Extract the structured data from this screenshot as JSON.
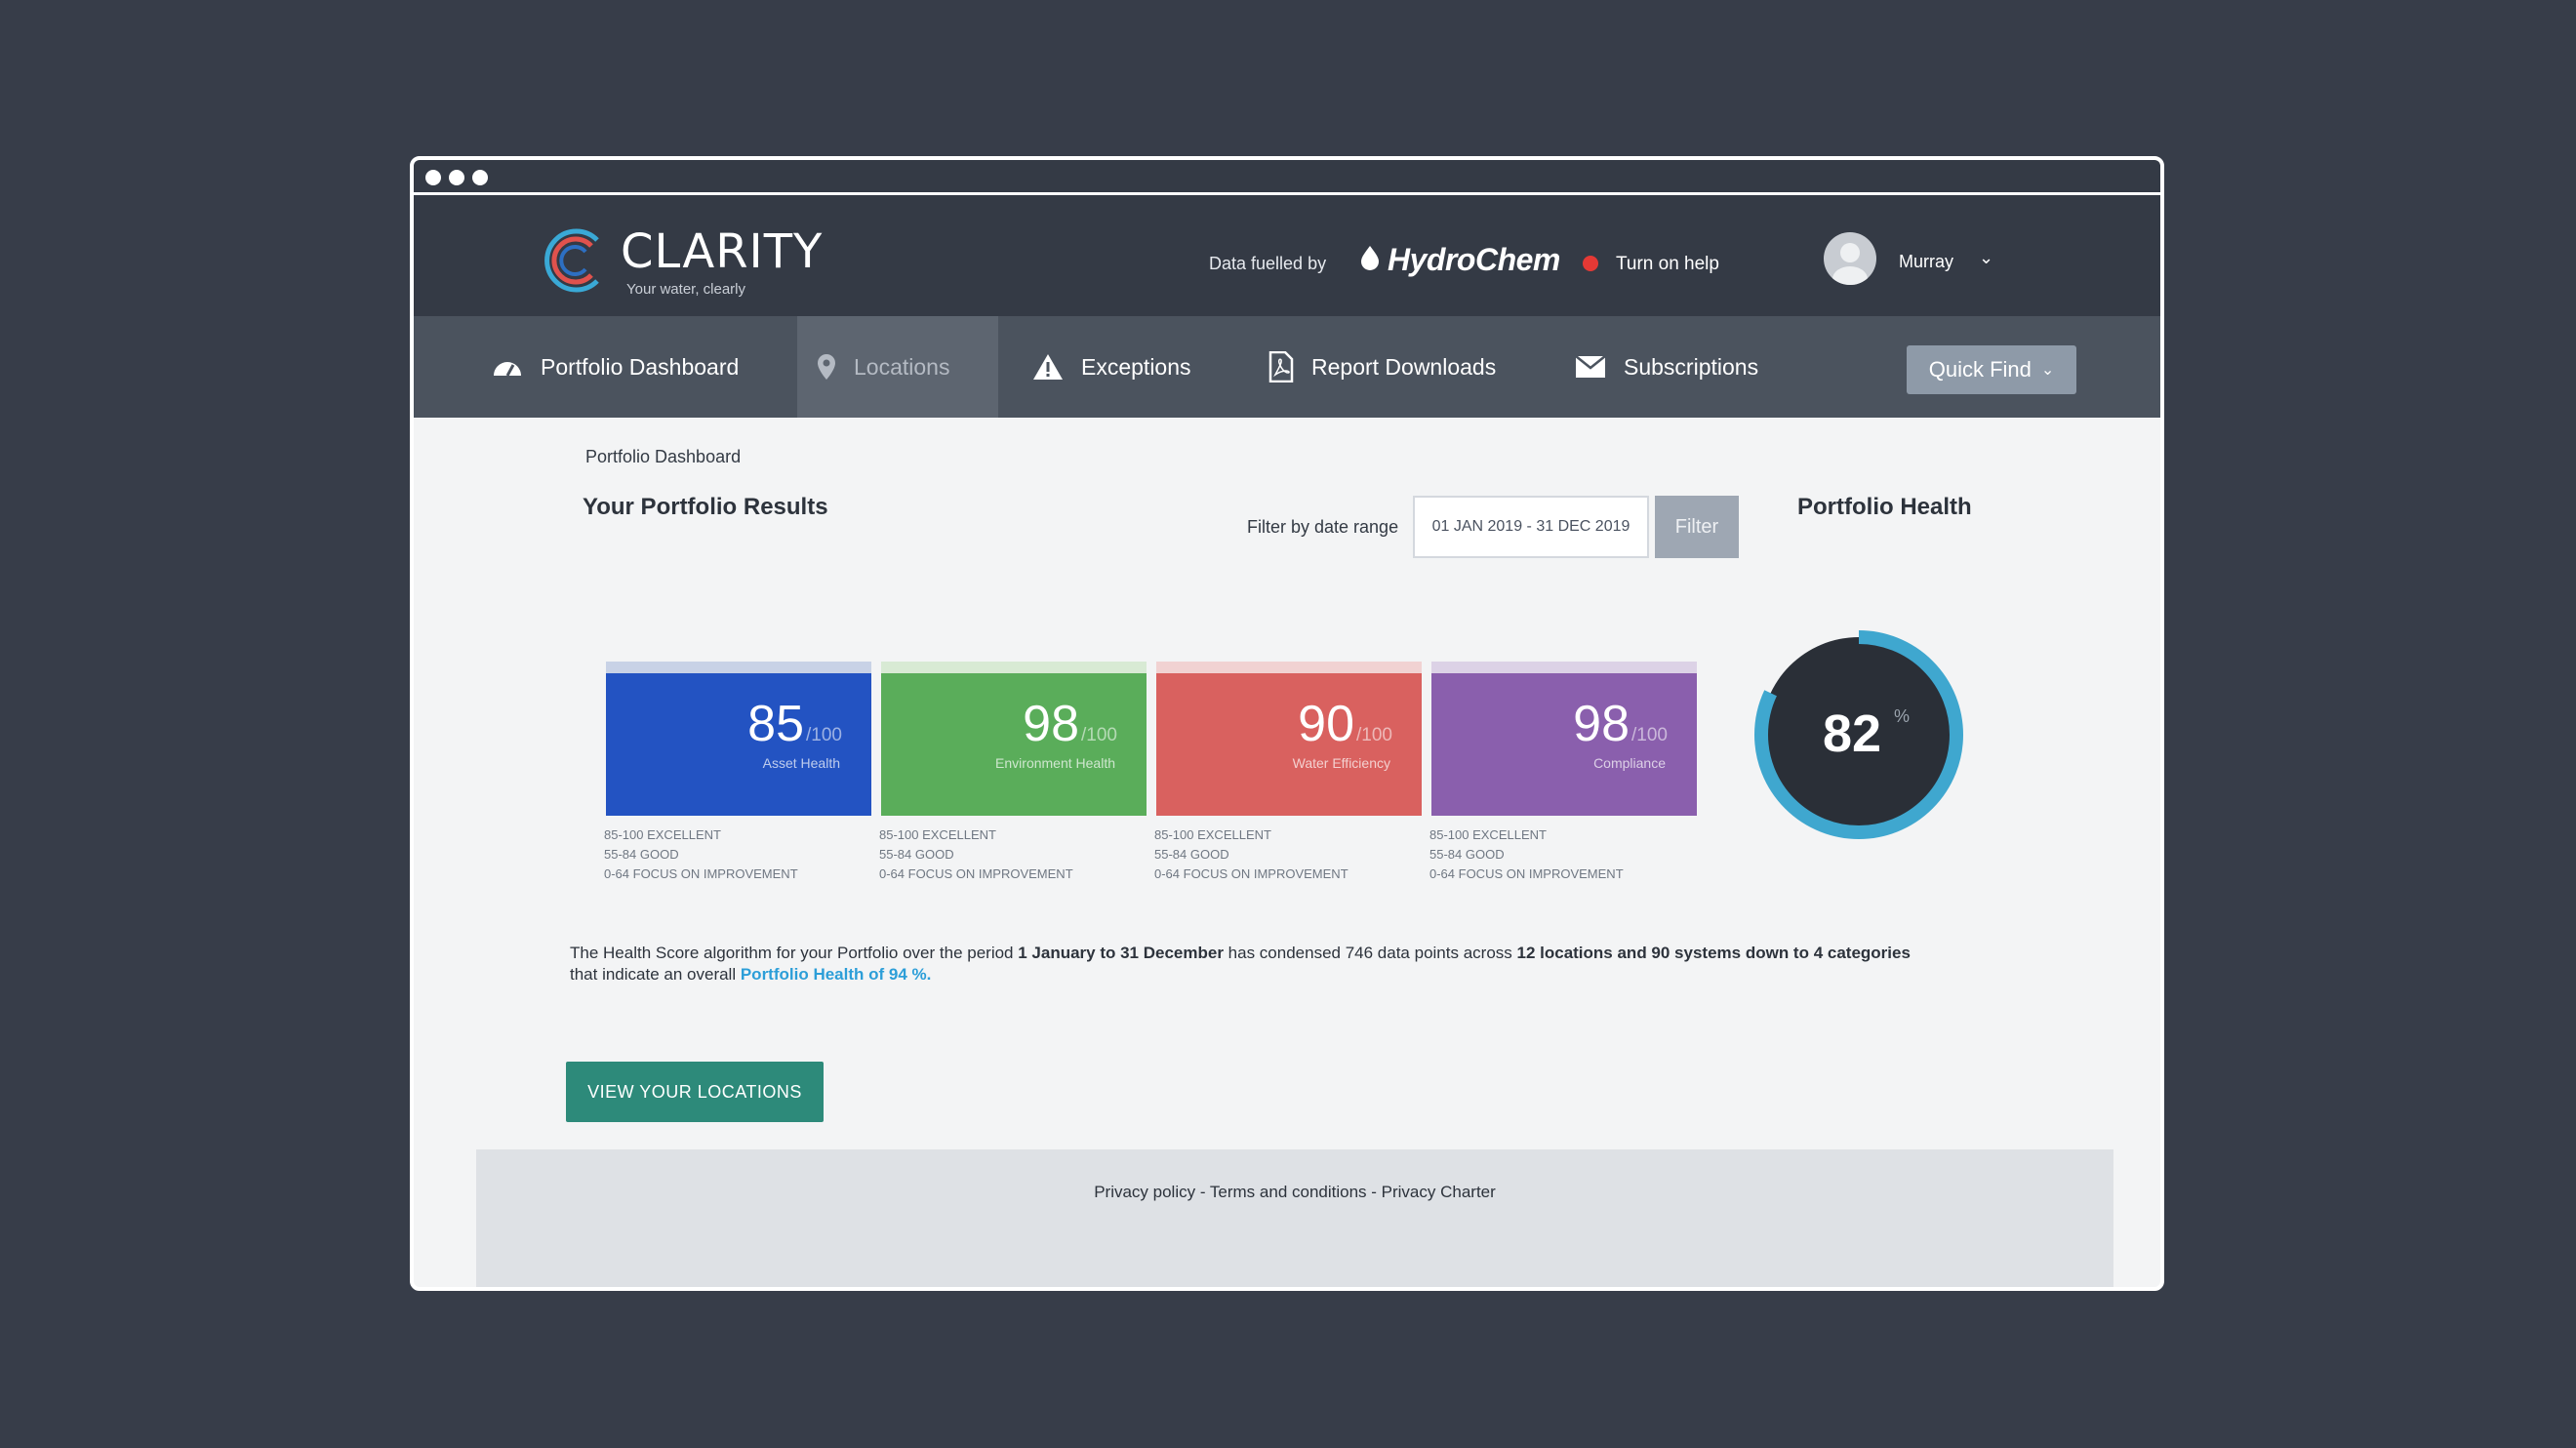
{
  "brand": {
    "name": "CLARITY",
    "tagline": "Your water, clearly"
  },
  "header": {
    "fuel_label": "Data fuelled by",
    "fuel_brand": "HydroChem",
    "help_label": "Turn on help",
    "user_name": "Murray"
  },
  "nav": {
    "items": [
      {
        "label": "Portfolio Dashboard",
        "icon": "gauge-icon"
      },
      {
        "label": "Locations",
        "icon": "map-pin-icon",
        "active": true
      },
      {
        "label": "Exceptions",
        "icon": "warning-icon"
      },
      {
        "label": "Report Downloads",
        "icon": "pdf-icon"
      },
      {
        "label": "Subscriptions",
        "icon": "envelope-icon"
      }
    ],
    "quick_find": "Quick Find"
  },
  "breadcrumb": "Portfolio Dashboard",
  "results_heading": "Your Portfolio Results",
  "filter": {
    "label": "Filter by date range",
    "value": "01 JAN 2019 - 31 DEC 2019",
    "button": "Filter"
  },
  "health_heading": "Portfolio Health",
  "tiles": [
    {
      "score": "85",
      "max": "/100",
      "label": "Asset Health",
      "color": "#2353c2",
      "top": "#c8d2e6"
    },
    {
      "score": "98",
      "max": "/100",
      "label": "Environment Health",
      "color": "#5aad5a",
      "top": "#d8ead4"
    },
    {
      "score": "90",
      "max": "/100",
      "label": "Water Efficiency",
      "color": "#d9615f",
      "top": "#f1d2d2"
    },
    {
      "score": "98",
      "max": "/100",
      "label": "Compliance",
      "color": "#8a5fad",
      "top": "#dcd2e6"
    }
  ],
  "legend": [
    "85-100 EXCELLENT",
    "55-84 GOOD",
    "0-64 FOCUS ON IMPROVEMENT"
  ],
  "health_score": {
    "value": "82",
    "unit": "%",
    "fraction": 0.82,
    "ring_color": "#3fa7cf"
  },
  "summary": {
    "p1": "The Health Score algorithm for your Portfolio over the period ",
    "b1": "1 January to 31 December",
    "p2": " has condensed 746 data points across ",
    "b2": "12 locations and 90 systems down to 4 categories",
    "p3": " that indicate an overall ",
    "link": "Portfolio Health of 94 %."
  },
  "cta": "VIEW YOUR LOCATIONS",
  "footer": {
    "links": "Privacy policy - Terms and conditions - Privacy Charter"
  }
}
